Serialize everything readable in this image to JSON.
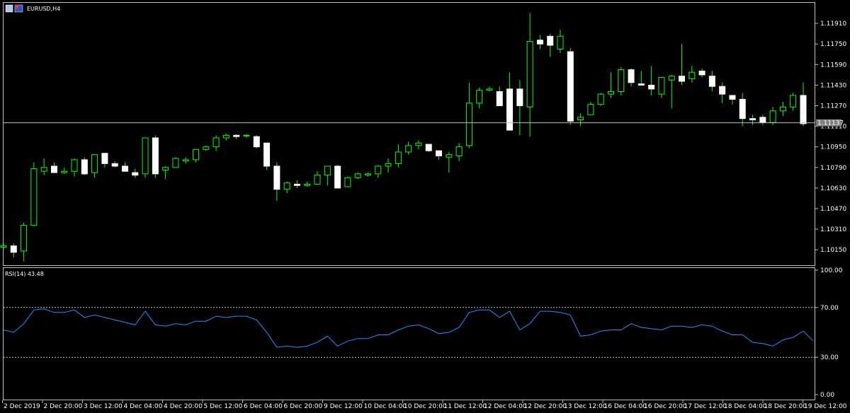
{
  "window_title": "EURUSD,H4",
  "colors": {
    "bull_candle": "#000000",
    "bull_wick": "#00ff00",
    "bear_candle": "#ffffff",
    "rsi_line": "#1e90ff",
    "frame": "#c0c0c0",
    "price_line": "#c0c0c0"
  },
  "chart_data": [
    {
      "type": "candlestick",
      "title": "EURUSD,H4",
      "yticks": [
        "1.11910",
        "1.11750",
        "1.11590",
        "1.11430",
        "1.11270",
        "1.11110",
        "1.10950",
        "1.10790",
        "1.10630",
        "1.10470",
        "1.10310",
        "1.10150"
      ],
      "ylim": [
        1.1003,
        1.1207
      ],
      "current_price": "1.11137",
      "xticks": [
        "2 Dec 2019",
        "2 Dec 20:00",
        "3 Dec 12:00",
        "4 Dec 04:00",
        "4 Dec 20:00",
        "5 Dec 12:00",
        "6 Dec 04:00",
        "6 Dec 20:00",
        "9 Dec 12:00",
        "10 Dec 04:00",
        "10 Dec 20:00",
        "11 Dec 12:00",
        "12 Dec 04:00",
        "12 Dec 20:00",
        "13 Dec 12:00",
        "16 Dec 04:00",
        "16 Dec 20:00",
        "17 Dec 12:00",
        "18 Dec 04:00",
        "18 Dec 20:00",
        "19 Dec 12:00"
      ],
      "ohlc": [
        [
          1.1017,
          1.102,
          1.1015,
          1.1018
        ],
        [
          1.1018,
          1.102,
          1.1009,
          1.1013
        ],
        [
          1.1014,
          1.1036,
          1.1006,
          1.1034
        ],
        [
          1.1034,
          1.1083,
          1.1033,
          1.1078
        ],
        [
          1.1076,
          1.1086,
          1.1073,
          1.1079
        ],
        [
          1.108,
          1.1083,
          1.1075,
          1.1075
        ],
        [
          1.1075,
          1.1079,
          1.1074,
          1.1076
        ],
        [
          1.1076,
          1.1086,
          1.1072,
          1.1085
        ],
        [
          1.1085,
          1.1087,
          1.1073,
          1.1074
        ],
        [
          1.1075,
          1.1088,
          1.1071,
          1.1089
        ],
        [
          1.109,
          1.1087,
          1.1079,
          1.1082
        ],
        [
          1.1082,
          1.1084,
          1.1079,
          1.108
        ],
        [
          1.108,
          1.1083,
          1.1076,
          1.1076
        ],
        [
          1.1075,
          1.1078,
          1.1071,
          1.1073
        ],
        [
          1.1074,
          1.1102,
          1.1071,
          1.1102
        ],
        [
          1.1102,
          1.1104,
          1.1071,
          1.1074
        ],
        [
          1.1077,
          1.108,
          1.107,
          1.1079
        ],
        [
          1.1079,
          1.1087,
          1.108,
          1.1086
        ],
        [
          1.1084,
          1.1087,
          1.1082,
          1.1085
        ],
        [
          1.1085,
          1.1092,
          1.1083,
          1.1093
        ],
        [
          1.1093,
          1.1096,
          1.1092,
          1.1095
        ],
        [
          1.1095,
          1.1104,
          1.1092,
          1.1102
        ],
        [
          1.1102,
          1.1105,
          1.11,
          1.1104
        ],
        [
          1.1104,
          1.1105,
          1.1101,
          1.1103
        ],
        [
          1.1104,
          1.1105,
          1.1102,
          1.1104
        ],
        [
          1.1103,
          1.1104,
          1.1094,
          1.1095
        ],
        [
          1.1098,
          1.1095,
          1.1077,
          1.108
        ],
        [
          1.108,
          1.1083,
          1.1053,
          1.1062
        ],
        [
          1.1062,
          1.1068,
          1.1059,
          1.1067
        ],
        [
          1.1066,
          1.1069,
          1.1063,
          1.1065
        ],
        [
          1.1065,
          1.1068,
          1.1064,
          1.1066
        ],
        [
          1.1066,
          1.1076,
          1.1066,
          1.1073
        ],
        [
          1.1073,
          1.108,
          1.1065,
          1.108
        ],
        [
          1.108,
          1.1081,
          1.1063,
          1.1063
        ],
        [
          1.1064,
          1.1072,
          1.1064,
          1.1071
        ],
        [
          1.1071,
          1.1075,
          1.107,
          1.1074
        ],
        [
          1.1073,
          1.1075,
          1.1072,
          1.1074
        ],
        [
          1.1074,
          1.1081,
          1.1071,
          1.108
        ],
        [
          1.108,
          1.1086,
          1.1075,
          1.1082
        ],
        [
          1.1082,
          1.1097,
          1.1079,
          1.1091
        ],
        [
          1.1091,
          1.1099,
          1.1089,
          1.1096
        ],
        [
          1.1096,
          1.11,
          1.1093,
          1.1098
        ],
        [
          1.1097,
          1.1096,
          1.1091,
          1.1092
        ],
        [
          1.1092,
          1.1091,
          1.1085,
          1.1088
        ],
        [
          1.1087,
          1.1091,
          1.1075,
          1.1089
        ],
        [
          1.1088,
          1.1098,
          1.1084,
          1.1095
        ],
        [
          1.1096,
          1.1145,
          1.1094,
          1.1129
        ],
        [
          1.1129,
          1.1141,
          1.1125,
          1.1139
        ],
        [
          1.1139,
          1.1142,
          1.1138,
          1.114
        ],
        [
          1.1138,
          1.1142,
          1.1127,
          1.1127
        ],
        [
          1.114,
          1.1153,
          1.1124,
          1.1108
        ],
        [
          1.114,
          1.1147,
          1.1104,
          1.1127
        ],
        [
          1.1126,
          1.1199,
          1.1103,
          1.1177
        ],
        [
          1.1178,
          1.1182,
          1.1171,
          1.1175
        ],
        [
          1.1181,
          1.1183,
          1.1165,
          1.1174
        ],
        [
          1.1171,
          1.1186,
          1.1168,
          1.1181
        ],
        [
          1.1169,
          1.1172,
          1.1112,
          1.1115
        ],
        [
          1.1116,
          1.1121,
          1.1111,
          1.1118
        ],
        [
          1.112,
          1.113,
          1.112,
          1.1128
        ],
        [
          1.1128,
          1.1137,
          1.1127,
          1.1136
        ],
        [
          1.1136,
          1.1153,
          1.1133,
          1.1138
        ],
        [
          1.1138,
          1.1157,
          1.1135,
          1.1155
        ],
        [
          1.1155,
          1.1156,
          1.1142,
          1.1145
        ],
        [
          1.1144,
          1.1154,
          1.1143,
          1.1143
        ],
        [
          1.1143,
          1.1158,
          1.1135,
          1.114
        ],
        [
          1.1136,
          1.1149,
          1.1133,
          1.1149
        ],
        [
          1.1147,
          1.1151,
          1.1125,
          1.115
        ],
        [
          1.115,
          1.1175,
          1.1143,
          1.1146
        ],
        [
          1.1148,
          1.1158,
          1.1145,
          1.1153
        ],
        [
          1.1154,
          1.1156,
          1.1149,
          1.1151
        ],
        [
          1.115,
          1.1154,
          1.1138,
          1.1142
        ],
        [
          1.1142,
          1.1145,
          1.1129,
          1.1136
        ],
        [
          1.1135,
          1.1133,
          1.1128,
          1.1132
        ],
        [
          1.1132,
          1.1137,
          1.1111,
          1.1117
        ],
        [
          1.1117,
          1.112,
          1.1112,
          1.1116
        ],
        [
          1.1118,
          1.112,
          1.1112,
          1.1114
        ],
        [
          1.1114,
          1.1126,
          1.1112,
          1.1123
        ],
        [
          1.1123,
          1.113,
          1.1119,
          1.1126
        ],
        [
          1.1126,
          1.1137,
          1.1123,
          1.1135
        ],
        [
          1.1135,
          1.1145,
          1.1111,
          1.1113
        ]
      ]
    },
    {
      "type": "line",
      "title": "RSI(14) 43.48",
      "ylim": [
        0,
        100
      ],
      "yticks": [
        "100.00",
        "70.00",
        "30.00",
        "0.00"
      ],
      "levels": [
        70,
        30
      ],
      "values": [
        52,
        50,
        57,
        68,
        69,
        66,
        66,
        68,
        62,
        64,
        62,
        60,
        58,
        56,
        67,
        56,
        55,
        57,
        56,
        59,
        59,
        63,
        62,
        63,
        63,
        60,
        50,
        38,
        39,
        38,
        39,
        42,
        47,
        39,
        43,
        45,
        45,
        48,
        48,
        52,
        55,
        56,
        53,
        49,
        50,
        54,
        66,
        68,
        68,
        62,
        67,
        52,
        57,
        67,
        67,
        66,
        64,
        47,
        48,
        51,
        52,
        52,
        57,
        54,
        53,
        52,
        55,
        55,
        54,
        56,
        55,
        51,
        48,
        48,
        42,
        41,
        39,
        44,
        46,
        51,
        43
      ]
    }
  ]
}
